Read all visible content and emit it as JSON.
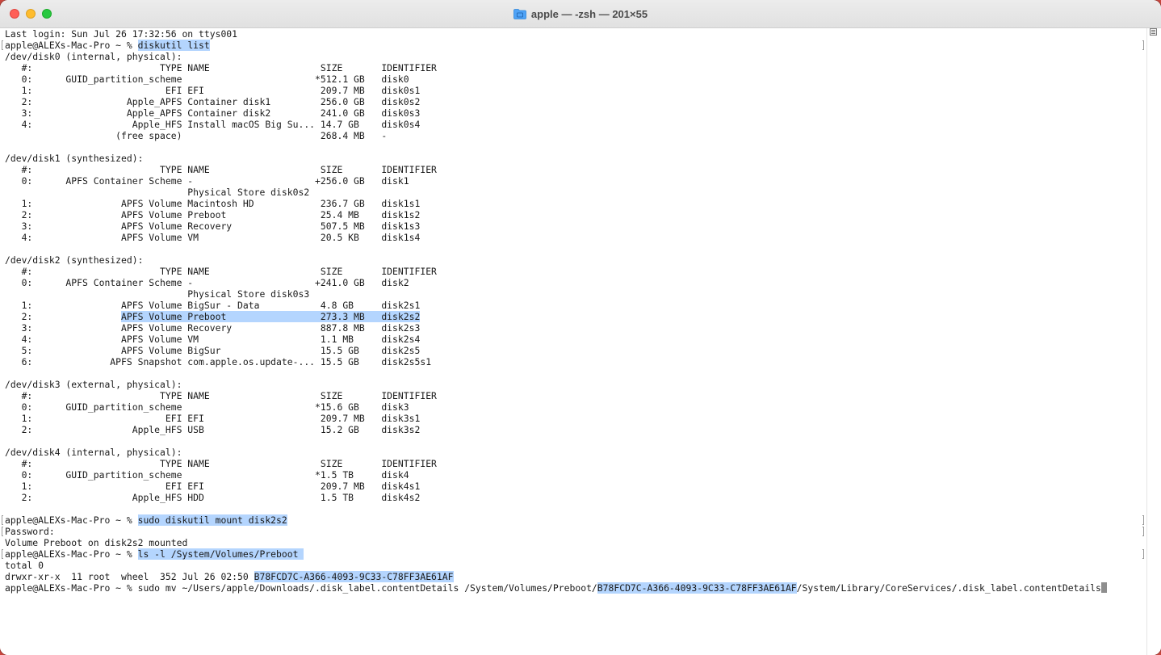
{
  "window": {
    "title": "apple — -zsh — 201×55",
    "colors": {
      "selection": "#b4d5fe",
      "text": "#1a1a1a",
      "close": "#ff5f57",
      "minimize": "#febc2e",
      "zoom": "#28c840",
      "folder_icon": "#4fa3f7"
    },
    "icons": [
      "close-button",
      "minimize-button",
      "zoom-button",
      "folder-icon",
      "scroll-menu-icon"
    ]
  },
  "terminal": {
    "lines": [
      {
        "segments": [
          {
            "text": "Last login: Sun Jul 26 17:32:56 on ttys001"
          }
        ]
      },
      {
        "mark": true,
        "segments": [
          {
            "text": "apple@ALEXs-Mac-Pro ~ % "
          },
          {
            "text": "diskutil list",
            "hl": true
          }
        ]
      },
      {
        "segments": [
          {
            "text": "/dev/disk0 (internal, physical):"
          }
        ]
      },
      {
        "segments": [
          {
            "text": "   #:                       TYPE NAME                    SIZE       IDENTIFIER"
          }
        ]
      },
      {
        "segments": [
          {
            "text": "   0:      GUID_partition_scheme                        *512.1 GB   disk0"
          }
        ]
      },
      {
        "segments": [
          {
            "text": "   1:                        EFI EFI                     209.7 MB   disk0s1"
          }
        ]
      },
      {
        "segments": [
          {
            "text": "   2:                 Apple_APFS Container disk1         256.0 GB   disk0s2"
          }
        ]
      },
      {
        "segments": [
          {
            "text": "   3:                 Apple_APFS Container disk2         241.0 GB   disk0s3"
          }
        ]
      },
      {
        "segments": [
          {
            "text": "   4:                  Apple_HFS Install macOS Big Su... 14.7 GB    disk0s4"
          }
        ]
      },
      {
        "segments": [
          {
            "text": "                    (free space)                         268.4 MB   -"
          }
        ]
      },
      {
        "segments": [
          {
            "text": ""
          }
        ]
      },
      {
        "segments": [
          {
            "text": "/dev/disk1 (synthesized):"
          }
        ]
      },
      {
        "segments": [
          {
            "text": "   #:                       TYPE NAME                    SIZE       IDENTIFIER"
          }
        ]
      },
      {
        "segments": [
          {
            "text": "   0:      APFS Container Scheme -                      +256.0 GB   disk1"
          }
        ]
      },
      {
        "segments": [
          {
            "text": "                                 Physical Store disk0s2"
          }
        ]
      },
      {
        "segments": [
          {
            "text": "   1:                APFS Volume Macintosh HD            236.7 GB   disk1s1"
          }
        ]
      },
      {
        "segments": [
          {
            "text": "   2:                APFS Volume Preboot                 25.4 MB    disk1s2"
          }
        ]
      },
      {
        "segments": [
          {
            "text": "   3:                APFS Volume Recovery                507.5 MB   disk1s3"
          }
        ]
      },
      {
        "segments": [
          {
            "text": "   4:                APFS Volume VM                      20.5 KB    disk1s4"
          }
        ]
      },
      {
        "segments": [
          {
            "text": ""
          }
        ]
      },
      {
        "segments": [
          {
            "text": "/dev/disk2 (synthesized):"
          }
        ]
      },
      {
        "segments": [
          {
            "text": "   #:                       TYPE NAME                    SIZE       IDENTIFIER"
          }
        ]
      },
      {
        "segments": [
          {
            "text": "   0:      APFS Container Scheme -                      +241.0 GB   disk2"
          }
        ]
      },
      {
        "segments": [
          {
            "text": "                                 Physical Store disk0s3"
          }
        ]
      },
      {
        "segments": [
          {
            "text": "   1:                APFS Volume BigSur - Data           4.8 GB     disk2s1"
          }
        ]
      },
      {
        "segments": [
          {
            "text": "   2:                "
          },
          {
            "text": "APFS Volume Preboot                 273.3 MB   disk2s2",
            "hl": true
          }
        ]
      },
      {
        "segments": [
          {
            "text": "   3:                APFS Volume Recovery                887.8 MB   disk2s3"
          }
        ]
      },
      {
        "segments": [
          {
            "text": "   4:                APFS Volume VM                      1.1 MB     disk2s4"
          }
        ]
      },
      {
        "segments": [
          {
            "text": "   5:                APFS Volume BigSur                  15.5 GB    disk2s5"
          }
        ]
      },
      {
        "segments": [
          {
            "text": "   6:              APFS Snapshot com.apple.os.update-... 15.5 GB    disk2s5s1"
          }
        ]
      },
      {
        "segments": [
          {
            "text": ""
          }
        ]
      },
      {
        "segments": [
          {
            "text": "/dev/disk3 (external, physical):"
          }
        ]
      },
      {
        "segments": [
          {
            "text": "   #:                       TYPE NAME                    SIZE       IDENTIFIER"
          }
        ]
      },
      {
        "segments": [
          {
            "text": "   0:      GUID_partition_scheme                        *15.6 GB    disk3"
          }
        ]
      },
      {
        "segments": [
          {
            "text": "   1:                        EFI EFI                     209.7 MB   disk3s1"
          }
        ]
      },
      {
        "segments": [
          {
            "text": "   2:                  Apple_HFS USB                     15.2 GB    disk3s2"
          }
        ]
      },
      {
        "segments": [
          {
            "text": ""
          }
        ]
      },
      {
        "segments": [
          {
            "text": "/dev/disk4 (internal, physical):"
          }
        ]
      },
      {
        "segments": [
          {
            "text": "   #:                       TYPE NAME                    SIZE       IDENTIFIER"
          }
        ]
      },
      {
        "segments": [
          {
            "text": "   0:      GUID_partition_scheme                        *1.5 TB     disk4"
          }
        ]
      },
      {
        "segments": [
          {
            "text": "   1:                        EFI EFI                     209.7 MB   disk4s1"
          }
        ]
      },
      {
        "segments": [
          {
            "text": "   2:                  Apple_HFS HDD                     1.5 TB     disk4s2"
          }
        ]
      },
      {
        "segments": [
          {
            "text": ""
          }
        ]
      },
      {
        "mark": true,
        "segments": [
          {
            "text": "apple@ALEXs-Mac-Pro ~ % "
          },
          {
            "text": "sudo diskutil mount disk2s2",
            "hl": true
          }
        ]
      },
      {
        "mark": true,
        "segments": [
          {
            "text": "Password:"
          }
        ]
      },
      {
        "segments": [
          {
            "text": "Volume Preboot on disk2s2 mounted"
          }
        ]
      },
      {
        "mark": true,
        "segments": [
          {
            "text": "apple@ALEXs-Mac-Pro ~ % "
          },
          {
            "text": "ls -l /System/Volumes/Preboot ",
            "hl": true
          }
        ]
      },
      {
        "segments": [
          {
            "text": "total 0"
          }
        ]
      },
      {
        "segments": [
          {
            "text": "drwxr-xr-x  11 root  wheel  352 Jul 26 02:50 "
          },
          {
            "text": "B78FCD7C-A366-4093-9C33-C78FF3AE61AF",
            "hl": true
          }
        ]
      },
      {
        "cursor": true,
        "segments": [
          {
            "text": "apple@ALEXs-Mac-Pro ~ % sudo mv ~/Users/apple/Downloads/.disk_label.contentDetails /System/Volumes/Preboot/"
          },
          {
            "text": "B78FCD7C-A366-4093-9C33-C78FF3AE61AF",
            "hl": true
          },
          {
            "text": "/System/Library/CoreServices/.disk_label.contentDetails"
          }
        ]
      }
    ]
  }
}
